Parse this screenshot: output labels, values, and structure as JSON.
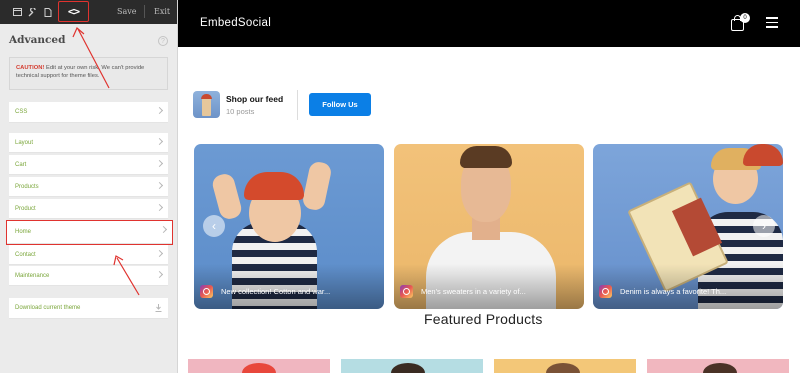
{
  "editor": {
    "toolbar": {
      "save": "Save",
      "exit": "Exit",
      "code_glyph": "<>",
      "icons": [
        "window-icon",
        "wrench-icon",
        "file-icon",
        "code-icon"
      ]
    },
    "advanced_title": "Advanced",
    "help_glyph": "?",
    "caution": {
      "label": "CAUTION!",
      "text": "Edit at your own risk. We can't provide technical support for theme files."
    },
    "css_label": "CSS",
    "sections": [
      "Layout",
      "Cart",
      "Products",
      "Product",
      "Home",
      "Contact",
      "Maintenance"
    ],
    "download_label": "Download current theme",
    "annotation_color": "#e0332f"
  },
  "store": {
    "brand": "EmbedSocial",
    "cart_count": "0",
    "feed": {
      "title": "Shop our feed",
      "posts": "10 posts",
      "follow": "Follow Us",
      "accent": "#0b7fe6"
    },
    "posts": [
      {
        "caption": "New collection! Cotton and war..."
      },
      {
        "caption": "Men's sweaters in a variety of..."
      },
      {
        "caption": "Denim is always a favorite! Th..."
      }
    ],
    "featured_title": "Featured Products"
  }
}
